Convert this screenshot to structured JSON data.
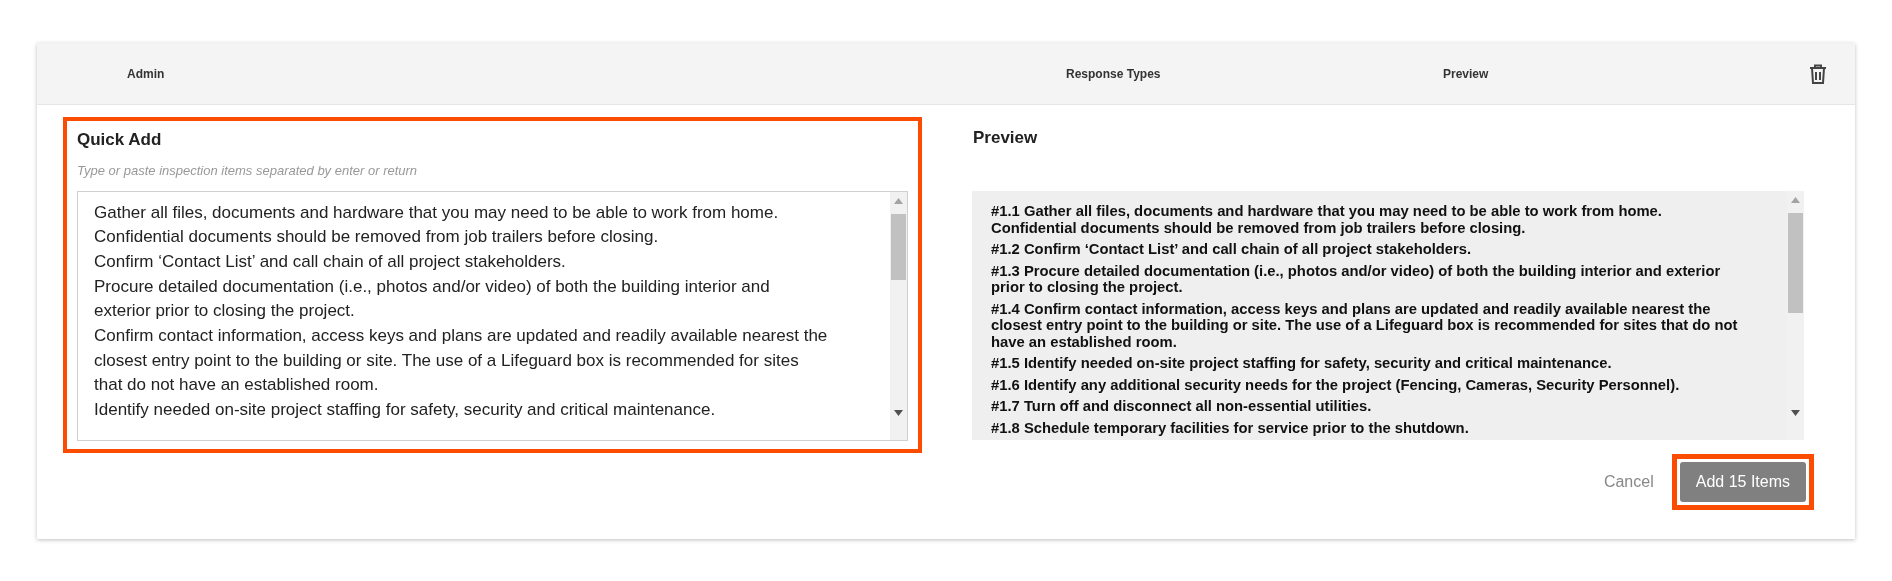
{
  "header": {
    "columns": [
      "Admin",
      "Response Types",
      "Preview"
    ]
  },
  "quick_add": {
    "title": "Quick Add",
    "hint": "Type or paste inspection items separated by enter or return",
    "lines": [
      "Gather all files, documents and hardware that you may need to be able to work from home.",
      "Confidential documents should be removed from job trailers before closing.",
      "Confirm ‘Contact List’ and call chain of all project stakeholders.",
      "Procure detailed documentation (i.e., photos and/or video) of both the building interior and exterior prior to closing the project.",
      "Confirm contact information, access keys and plans are updated and readily available nearest the closest entry point to the building or site. The use of a Lifeguard box is recommended for sites that do not have an established room.",
      "Identify needed on-site project staffing for safety, security and critical maintenance."
    ]
  },
  "preview": {
    "title": "Preview",
    "items": [
      "#1.1 Gather all files, documents and hardware that you may need to be able to work from home. Confidential documents should be removed from job trailers before closing.",
      "#1.2 Confirm ‘Contact List’ and call chain of all project stakeholders.",
      "#1.3 Procure detailed documentation (i.e., photos and/or video) of both the building interior and exterior prior to closing the project.",
      "#1.4 Confirm contact information, access keys and plans are updated and readily available nearest the closest entry point to the building or site. The use of a Lifeguard box is recommended for sites that do not have an established room.",
      "#1.5 Identify needed on-site project staffing for safety, security and critical maintenance.",
      "#1.6 Identify any additional security needs for the project (Fencing, Cameras, Security Personnel).",
      "#1.7 Turn off and disconnect all non-essential utilities.",
      "#1.8 Schedule temporary facilities for service prior to the shutdown."
    ]
  },
  "buttons": {
    "cancel": "Cancel",
    "add": "Add 15 Items"
  }
}
